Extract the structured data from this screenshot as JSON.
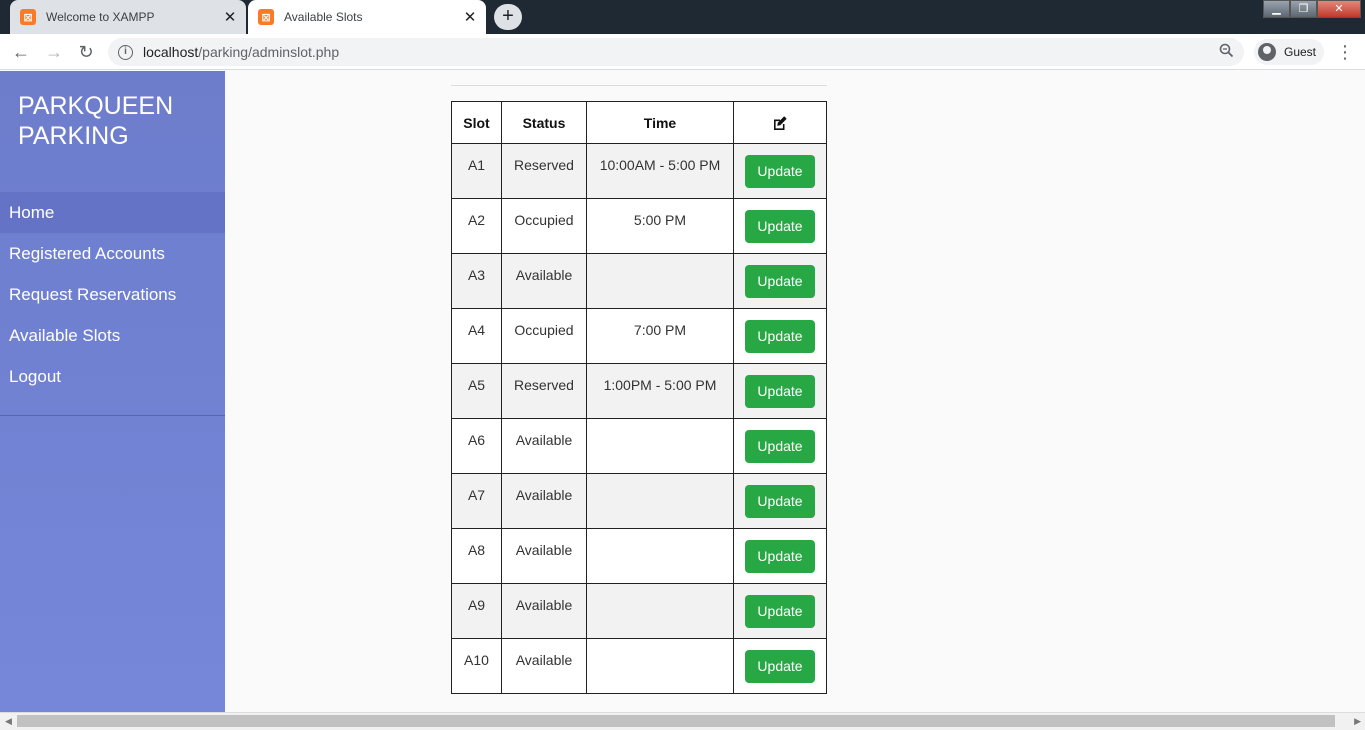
{
  "browser": {
    "tabs": [
      {
        "title": "Welcome to XAMPP",
        "active": false
      },
      {
        "title": "Available Slots",
        "active": true
      }
    ],
    "url_host": "localhost",
    "url_path": "/parking/adminslot.php",
    "profile_label": "Guest"
  },
  "sidebar": {
    "brand_line1": "PARKQUEEN",
    "brand_line2": "PARKING",
    "items": [
      {
        "label": "Home"
      },
      {
        "label": "Registered Accounts"
      },
      {
        "label": "Request Reservations"
      },
      {
        "label": "Available Slots"
      },
      {
        "label": "Logout"
      }
    ]
  },
  "table": {
    "headers": {
      "slot": "Slot",
      "status": "Status",
      "time": "Time",
      "action_icon": "edit-icon"
    },
    "button_label": "Update",
    "rows": [
      {
        "slot": "A1",
        "status": "Reserved",
        "time": "10:00AM - 5:00 PM"
      },
      {
        "slot": "A2",
        "status": "Occupied",
        "time": "5:00 PM"
      },
      {
        "slot": "A3",
        "status": "Available",
        "time": ""
      },
      {
        "slot": "A4",
        "status": "Occupied",
        "time": "7:00 PM"
      },
      {
        "slot": "A5",
        "status": "Reserved",
        "time": "1:00PM - 5:00 PM"
      },
      {
        "slot": "A6",
        "status": "Available",
        "time": ""
      },
      {
        "slot": "A7",
        "status": "Available",
        "time": ""
      },
      {
        "slot": "A8",
        "status": "Available",
        "time": ""
      },
      {
        "slot": "A9",
        "status": "Available",
        "time": ""
      },
      {
        "slot": "A10",
        "status": "Available",
        "time": ""
      }
    ]
  },
  "colors": {
    "sidebar": "#7080d4",
    "button": "#28a745",
    "xampp_icon": "#fb7a24"
  }
}
